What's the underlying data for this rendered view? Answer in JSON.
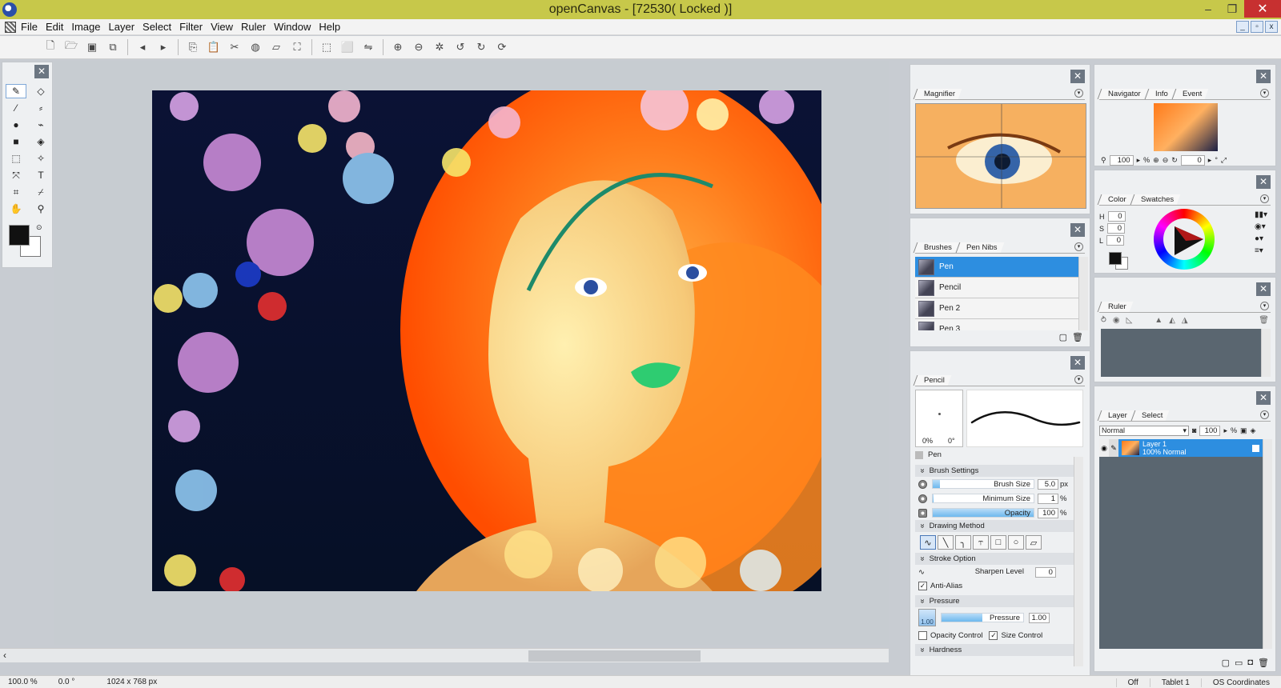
{
  "window": {
    "title": "openCanvas - [72530( Locked )]",
    "controls": [
      "–",
      "❐",
      "✕"
    ]
  },
  "menu": [
    "File",
    "Edit",
    "Image",
    "Layer",
    "Select",
    "Filter",
    "View",
    "Ruler",
    "Window",
    "Help"
  ],
  "mdi_controls": [
    "_",
    "▫",
    "x"
  ],
  "toolbar": {
    "icons": [
      "new-file-icon",
      "open-folder-icon",
      "save-icon",
      "save-all-icon",
      "sep",
      "prev-icon",
      "next-icon",
      "sep",
      "copy-icon",
      "paste-icon",
      "cut-icon",
      "fill-icon",
      "erase-icon",
      "transform-icon",
      "sep",
      "select-rect-icon",
      "select-deselect-icon",
      "select-invert-icon",
      "sep",
      "zoom-in-icon",
      "zoom-out-icon",
      "zoom-fit-icon",
      "rotate-left-icon",
      "rotate-right-icon",
      "rotate-reset-icon"
    ]
  },
  "tools": [
    {
      "name": "pen-tool",
      "glyph": "✎",
      "active": true
    },
    {
      "name": "eraser-tool",
      "glyph": "◇",
      "active": false
    },
    {
      "name": "brush-tool",
      "glyph": "⁄",
      "active": false
    },
    {
      "name": "airbrush-tool",
      "glyph": "⸗",
      "active": false
    },
    {
      "name": "watercolor-tool",
      "glyph": "●",
      "active": false
    },
    {
      "name": "smudge-tool",
      "glyph": "⌁",
      "active": false
    },
    {
      "name": "rect-fill-tool",
      "glyph": "■",
      "active": false
    },
    {
      "name": "bucket-tool",
      "glyph": "◈",
      "active": false
    },
    {
      "name": "select-tool",
      "glyph": "⬚",
      "active": false
    },
    {
      "name": "magic-wand-tool",
      "glyph": "✧",
      "active": false
    },
    {
      "name": "move-tool",
      "glyph": "⤧",
      "active": false
    },
    {
      "name": "text-tool",
      "glyph": "T",
      "active": false
    },
    {
      "name": "crop-tool",
      "glyph": "⌗",
      "active": false
    },
    {
      "name": "eyedropper-tool",
      "glyph": "⌿",
      "active": false
    },
    {
      "name": "hand-tool",
      "glyph": "✋",
      "active": false
    },
    {
      "name": "zoom-tool",
      "glyph": "⚲",
      "active": false
    }
  ],
  "colors": {
    "foreground": "#111111",
    "background": "#ffffff"
  },
  "magnifier": {
    "tab": "Magnifier"
  },
  "navigator": {
    "tabs": [
      "Navigator",
      "Info",
      "Event"
    ],
    "zoom": "100",
    "zoom_unit": "%",
    "rotation": "0",
    "rotation_unit": "°"
  },
  "color_panel": {
    "tabs": [
      "Color",
      "Swatches"
    ],
    "h_label": "H",
    "h": "0",
    "s_label": "S",
    "s": "0",
    "l_label": "L",
    "l": "0"
  },
  "brushes": {
    "tabs": [
      "Brushes",
      "Pen Nibs"
    ],
    "items": [
      {
        "label": "Pen",
        "selected": true
      },
      {
        "label": "Pencil",
        "selected": false
      },
      {
        "label": "Pen 2",
        "selected": false
      },
      {
        "label": "Pen 3",
        "selected": false
      }
    ]
  },
  "ruler": {
    "tab": "Ruler"
  },
  "brush_props": {
    "tab": "Pencil",
    "preview_pct": "0%",
    "preview_deg": "0°",
    "brush_name": "Pen",
    "sections": {
      "brush_settings": "Brush Settings",
      "drawing_method": "Drawing Method",
      "stroke_option": "Stroke Option",
      "pressure": "Pressure",
      "hardness": "Hardness"
    },
    "brush_size": {
      "label": "Brush Size",
      "value": "5.0",
      "unit": "px",
      "fill": 0.07
    },
    "min_size": {
      "label": "Minimum Size",
      "value": "1",
      "unit": "%",
      "fill": 0.01
    },
    "opacity": {
      "label": "Opacity",
      "value": "100",
      "unit": "%",
      "fill": 1.0
    },
    "sharpen": {
      "label": "Sharpen Level",
      "value": "0",
      "fill": 0
    },
    "anti_alias": {
      "label": "Anti-Alias",
      "checked": true
    },
    "pressure_curve": "1.00",
    "pressure_val": {
      "label": "Pressure",
      "value": "1.00",
      "fill": 0.5
    },
    "opacity_control": {
      "label": "Opacity Control",
      "checked": false
    },
    "size_control": {
      "label": "Size Control",
      "checked": true
    },
    "methods": [
      "∿",
      "╲",
      "╮",
      "⥾",
      "□",
      "○",
      "▱"
    ]
  },
  "layer_panel": {
    "tabs": [
      "Layer",
      "Select"
    ],
    "blend": "Normal",
    "opacity": "100",
    "opacity_unit": "%",
    "layers": [
      {
        "name": "Layer 1",
        "detail": "100% Normal",
        "selected": true
      }
    ]
  },
  "status": {
    "zoom": "100.0 %",
    "rotation": "0.0 °",
    "size": "1024 x 768 px",
    "right": [
      "Off",
      "Tablet 1",
      "OS Coordinates"
    ]
  }
}
